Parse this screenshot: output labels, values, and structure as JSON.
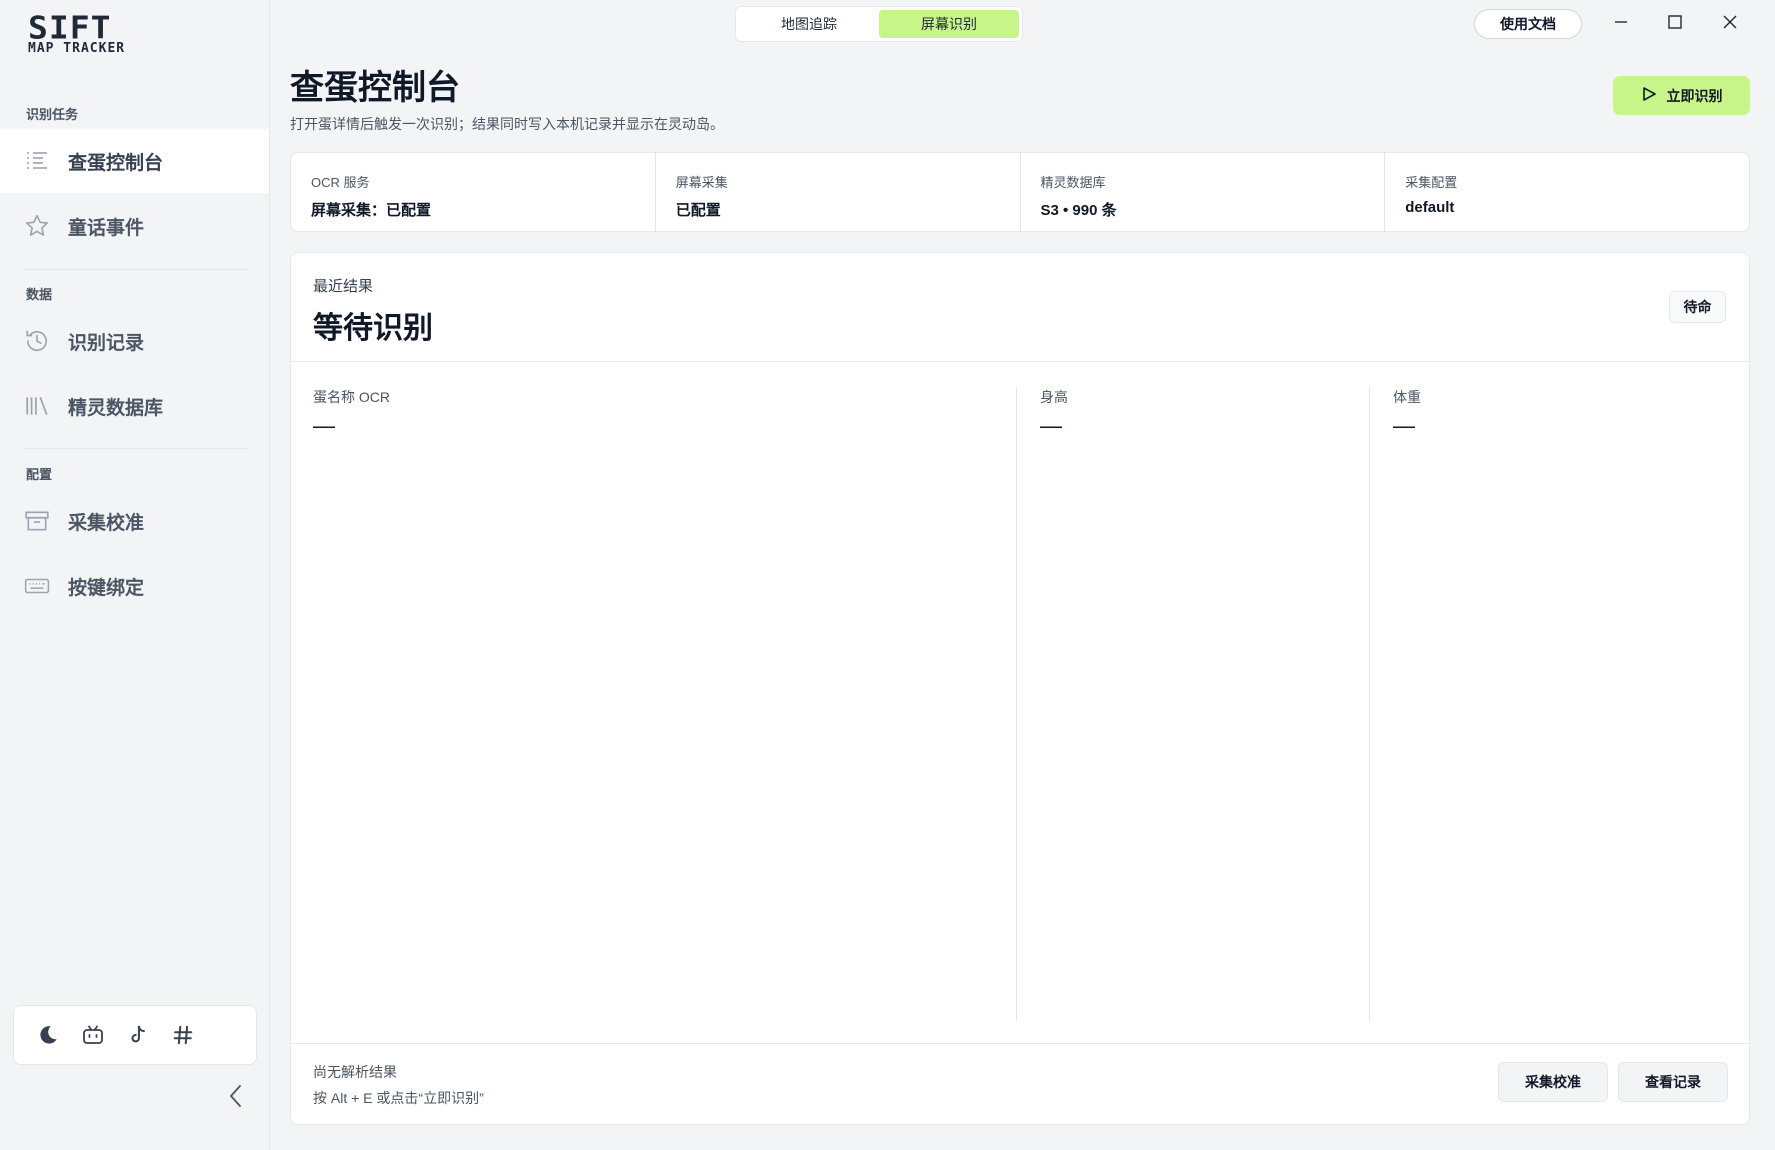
{
  "app": {
    "logo_main": "SIFT",
    "logo_sub": "MAP TRACKER"
  },
  "top_bar": {
    "modes": [
      {
        "label": "地图追踪",
        "active": false
      },
      {
        "label": "屏幕识别",
        "active": true
      }
    ],
    "docs_button": "使用文档",
    "window_controls": [
      "minimize-icon",
      "maximize-icon",
      "close-icon"
    ]
  },
  "sidebar": {
    "sections": [
      {
        "label": "识别任务"
      },
      {
        "label": "数据"
      },
      {
        "label": "配置"
      }
    ],
    "items": [
      {
        "label": "查蛋控制台",
        "icon": "list-icon",
        "active": true
      },
      {
        "label": "童话事件",
        "icon": "star-icon",
        "active": false
      },
      {
        "label": "识别记录",
        "icon": "history-icon",
        "active": false
      },
      {
        "label": "精灵数据库",
        "icon": "library-icon",
        "active": false
      },
      {
        "label": "采集校准",
        "icon": "tray-icon",
        "active": false
      },
      {
        "label": "按键绑定",
        "icon": "keyboard-icon",
        "active": false
      }
    ],
    "tools": [
      "moon-icon",
      "bilibili-icon",
      "tiktok-icon",
      "hash-icon"
    ],
    "collapse_icon": "chevron-left-icon"
  },
  "header": {
    "title": "查蛋控制台",
    "subtitle": "打开蛋详情后触发一次识别；结果同时写入本机记录并显示在灵动岛。",
    "primary_button": "立即识别",
    "primary_icon": "play-icon"
  },
  "status": [
    {
      "label": "OCR 服务",
      "value": "屏幕采集：已配置"
    },
    {
      "label": "屏幕采集",
      "value": "已配置"
    },
    {
      "label": "精灵数据库",
      "value": "S3 • 990 条"
    },
    {
      "label": "采集配置",
      "value": "default"
    }
  ],
  "result": {
    "kicker": "最近结果",
    "title": "等待识别",
    "badge": "待命",
    "columns": [
      {
        "label": "蛋名称 OCR",
        "value": "—"
      },
      {
        "label": "身高",
        "value": "—"
      },
      {
        "label": "体重",
        "value": "—"
      }
    ],
    "footer_status": "尚无解析结果",
    "footer_hint": "按 Alt + E 或点击“立即识别”",
    "buttons": [
      "采集校准",
      "查看记录"
    ]
  },
  "colors": {
    "accent": "#c7f58a",
    "background": "#f3f4f6",
    "card": "#ffffff",
    "border": "#e5e7eb"
  }
}
